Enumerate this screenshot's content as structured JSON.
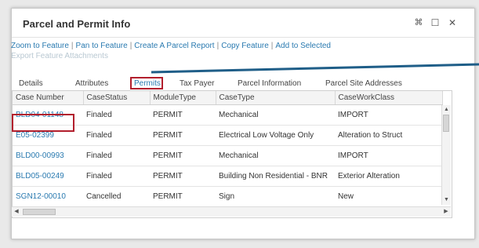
{
  "window": {
    "title": "Parcel and Permit Info",
    "controls": {
      "pin": "⌘",
      "maximize": "☐",
      "close": "✕"
    }
  },
  "links": {
    "items": [
      "Zoom to Feature",
      "Pan to Feature",
      "Create A Parcel Report",
      "Copy Feature",
      "Add to Selected"
    ],
    "separator": "|",
    "disabled_item": "Export Feature Attachments"
  },
  "tabs": [
    "Details",
    "Attributes",
    "Permits",
    "Tax Payer",
    "Parcel Information",
    "Parcel Site Addresses"
  ],
  "active_tab": "Permits",
  "table": {
    "columns": [
      "Case Number",
      "CaseStatus",
      "ModuleType",
      "CaseType",
      "CaseWorkClass"
    ],
    "rows": [
      [
        "BLD04-01148",
        "Finaled",
        "PERMIT",
        "Mechanical",
        "IMPORT"
      ],
      [
        "E05-02399",
        "Finaled",
        "PERMIT",
        "Electrical Low Voltage Only",
        "Alteration to Struct"
      ],
      [
        "BLD00-00993",
        "Finaled",
        "PERMIT",
        "Mechanical",
        "IMPORT"
      ],
      [
        "BLD05-00249",
        "Finaled",
        "PERMIT",
        "Building Non Residential - BNR",
        "Exterior Alteration"
      ],
      [
        "SGN12-00010",
        "Cancelled",
        "PERMIT",
        "Sign",
        "New"
      ]
    ]
  },
  "colors": {
    "link": "#2a7ab0",
    "highlight": "#b21f2d",
    "callout_line": "#1f5e88"
  }
}
